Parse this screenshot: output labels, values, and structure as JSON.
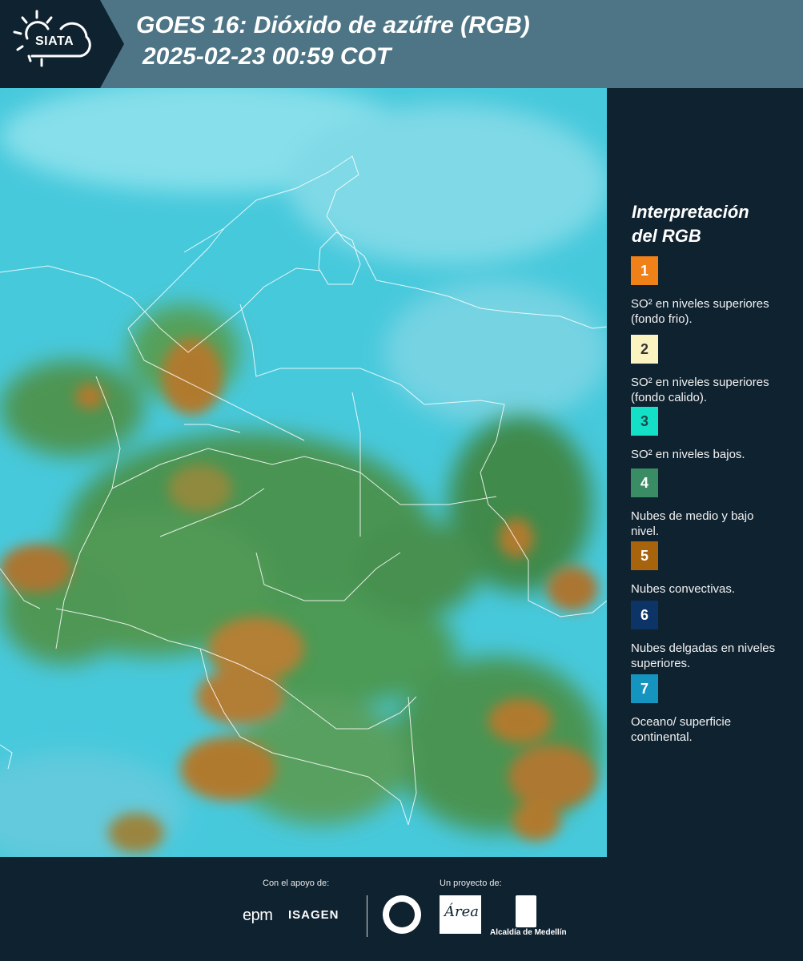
{
  "header": {
    "logo_text": "SIATA",
    "title_line1": "GOES 16: Dióxido de azúfre (RGB)",
    "title_line2": "2025-02-23 00:59 COT",
    "background": "#4d7585",
    "logo_background": "#0f2230"
  },
  "legend": {
    "title_line1": "Interpretación",
    "title_line2": "del RGB",
    "items": [
      {
        "number": "1",
        "text": "SO² en niveles superiores (fondo frio).",
        "color": "#f08018",
        "number_color": "#ffffff"
      },
      {
        "number": "2",
        "text": "SO² en niveles superiores (fondo calido).",
        "color": "#fbf4c0",
        "number_color": "#333333"
      },
      {
        "number": "3",
        "text": "SO² en niveles bajos.",
        "color": "#14e0c8",
        "number_color": "#1a4a4a"
      },
      {
        "number": "4",
        "text": "Nubes de medio y bajo nivel.",
        "color": "#3a8c64",
        "number_color": "#ffffff"
      },
      {
        "number": "5",
        "text": "Nubes convectivas.",
        "color": "#a8640c",
        "number_color": "#ffffff"
      },
      {
        "number": "6",
        "text": "Nubes delgadas en niveles superiores.",
        "color": "#0d3466",
        "number_color": "#ffffff"
      },
      {
        "number": "7",
        "text": "Oceano/ superficie continental.",
        "color": "#1694c0",
        "number_color": "#ffffff"
      }
    ]
  },
  "footer": {
    "support_label": "Con el apoyo de:",
    "project_label": "Un proyecto de:",
    "epm": "epm",
    "isagen": "ISAGEN",
    "area_mark": "Área",
    "alcaldia": "Alcaldía de Medellín"
  },
  "map_colors": {
    "cyan": "#4fd0e0",
    "light_cyan": "#8ce4ee",
    "green": "#4f9a52",
    "orange": "#b07a2e",
    "border": "#ffffff"
  }
}
